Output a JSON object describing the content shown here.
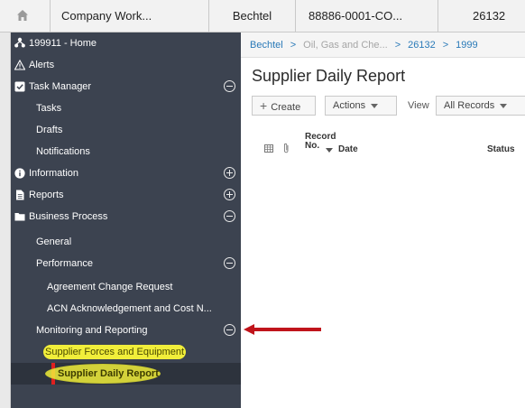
{
  "topbar": {
    "home_icon": "home-icon",
    "company": "Company Work...",
    "owner": "Bechtel",
    "project_code": "88886-0001-CO...",
    "project_number": "26132"
  },
  "sidebar": {
    "home": "199911 - Home",
    "alerts": "Alerts",
    "task_manager": "Task Manager",
    "tasks": "Tasks",
    "drafts": "Drafts",
    "notifications": "Notifications",
    "information": "Information",
    "reports": "Reports",
    "business_process": "Business Process",
    "general": "General",
    "performance": "Performance",
    "agreement_change_request": "Agreement Change Request",
    "acn_acknowledgement": "ACN Acknowledgement and Cost N...",
    "monitoring_reporting": "Monitoring and Reporting",
    "supplier_forces": "Supplier Forces and Equipment",
    "supplier_daily_report": "Supplier Daily Report"
  },
  "breadcrumb": {
    "items": [
      "Bechtel",
      "Oil, Gas and Che...",
      "26132",
      "1999"
    ]
  },
  "main": {
    "title": "Supplier Daily Report",
    "create_label": "Create",
    "actions_label": "Actions",
    "view_label": "View",
    "view_value": "All Records"
  },
  "grid": {
    "col_record_line1": "Record",
    "col_record_line2": "No.",
    "col_date": "Date",
    "col_status": "Status"
  },
  "colors": {
    "sidebar_bg": "#3c4350",
    "highlight_yellow": "#f1ee3a",
    "annotation_red": "#c0141b",
    "link_blue": "#2a7ab8"
  }
}
